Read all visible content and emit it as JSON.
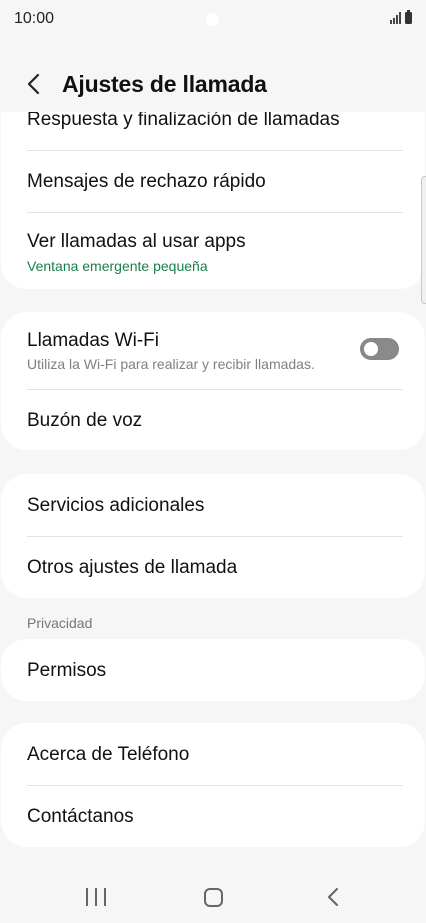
{
  "status_bar": {
    "time": "10:00",
    "icons": [
      "signal-icon",
      "battery-icon"
    ]
  },
  "header": {
    "title": "Ajustes de llamada",
    "back_icon": "chevron-left-icon"
  },
  "cards": {
    "first": {
      "items": [
        {
          "title": "Respuesta y finalización de llamadas"
        },
        {
          "title": "Mensajes de rechazo rápido"
        },
        {
          "title": "Ver llamadas al usar apps",
          "subtitle": "Ventana emergente pequeña"
        }
      ]
    },
    "second": {
      "wifi": {
        "title": "Llamadas Wi-Fi",
        "subtitle": "Utiliza la Wi-Fi para realizar y recibir llamadas.",
        "toggle_on": false
      },
      "voicemail": {
        "title": "Buzón de voz"
      }
    },
    "third": {
      "items": [
        {
          "title": "Servicios adicionales"
        },
        {
          "title": "Otros ajustes de llamada"
        }
      ]
    },
    "privacy": {
      "section_label": "Privacidad",
      "items": [
        {
          "title": "Permisos"
        }
      ]
    },
    "about": {
      "items": [
        {
          "title": "Acerca de Teléfono"
        },
        {
          "title": "Contáctanos"
        }
      ]
    }
  },
  "colors": {
    "background": "#f6f6f6",
    "card": "#ffffff",
    "accent_green": "#1a7f4b",
    "subtitle_gray": "#808080"
  },
  "nav_bar": {
    "icons": [
      "recents-icon",
      "home-icon",
      "back-icon"
    ]
  }
}
